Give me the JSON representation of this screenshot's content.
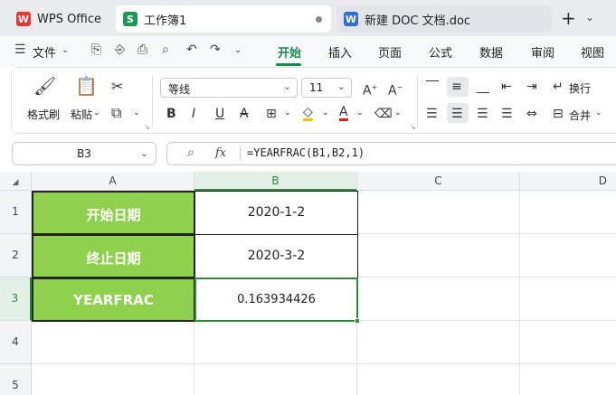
{
  "tabs": {
    "wps_office": "WPS Office",
    "sheet": "工作簿1",
    "doc": "新建 DOC 文档.doc",
    "sheet_logo": "S",
    "doc_logo": "W"
  },
  "menu": {
    "file": "文件",
    "start": "开始",
    "insert": "插入",
    "page": "页面",
    "formula": "公式",
    "data": "数据",
    "review": "审阅",
    "view": "视图"
  },
  "ribbon": {
    "format_painter": "格式刷",
    "paste": "粘贴",
    "font_name": "等线",
    "font_size": "11",
    "wrap": "换行",
    "merge": "合并"
  },
  "formula_bar": {
    "name_box": "B3",
    "formula": "=YEARFRAC(B1,B2,1)",
    "fx": "fx"
  },
  "columns": [
    "A",
    "B",
    "C",
    "D"
  ],
  "rows": [
    "1",
    "2",
    "3",
    "4",
    "5"
  ],
  "cells": {
    "a1": "开始日期",
    "a2": "终止日期",
    "a3": "YEARFRAC",
    "b1": "2020-1-2",
    "b2": "2020-3-2",
    "b3": "0.163934426"
  },
  "colors": {
    "accent": "#1a8a50",
    "header_fill": "#8fd14f",
    "selection": "#2f8a3c"
  }
}
